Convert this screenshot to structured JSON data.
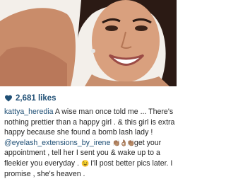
{
  "post": {
    "likes_count": "2,681 likes",
    "caption": {
      "username": "kattya_heredia",
      "text_1": "A wise man once told me ... There's nothing prettier than a happy girl . & this girl is extra happy because she found a bomb lash lady !",
      "mention": "@eyelash_extensions_by_irene",
      "emojis_1": "👏🏽👌🏽👏🏽",
      "text_2": "get your appointment , tell her I sent you & wake up to a fleekier you everyday .",
      "emoji_2": "😉",
      "text_3": " I'll post better pics later. I promise , she's heaven ."
    }
  },
  "icons": {
    "like": "heart-icon"
  },
  "colors": {
    "link_blue": "#1f4f75",
    "text": "#262626",
    "background": "#ffffff"
  }
}
